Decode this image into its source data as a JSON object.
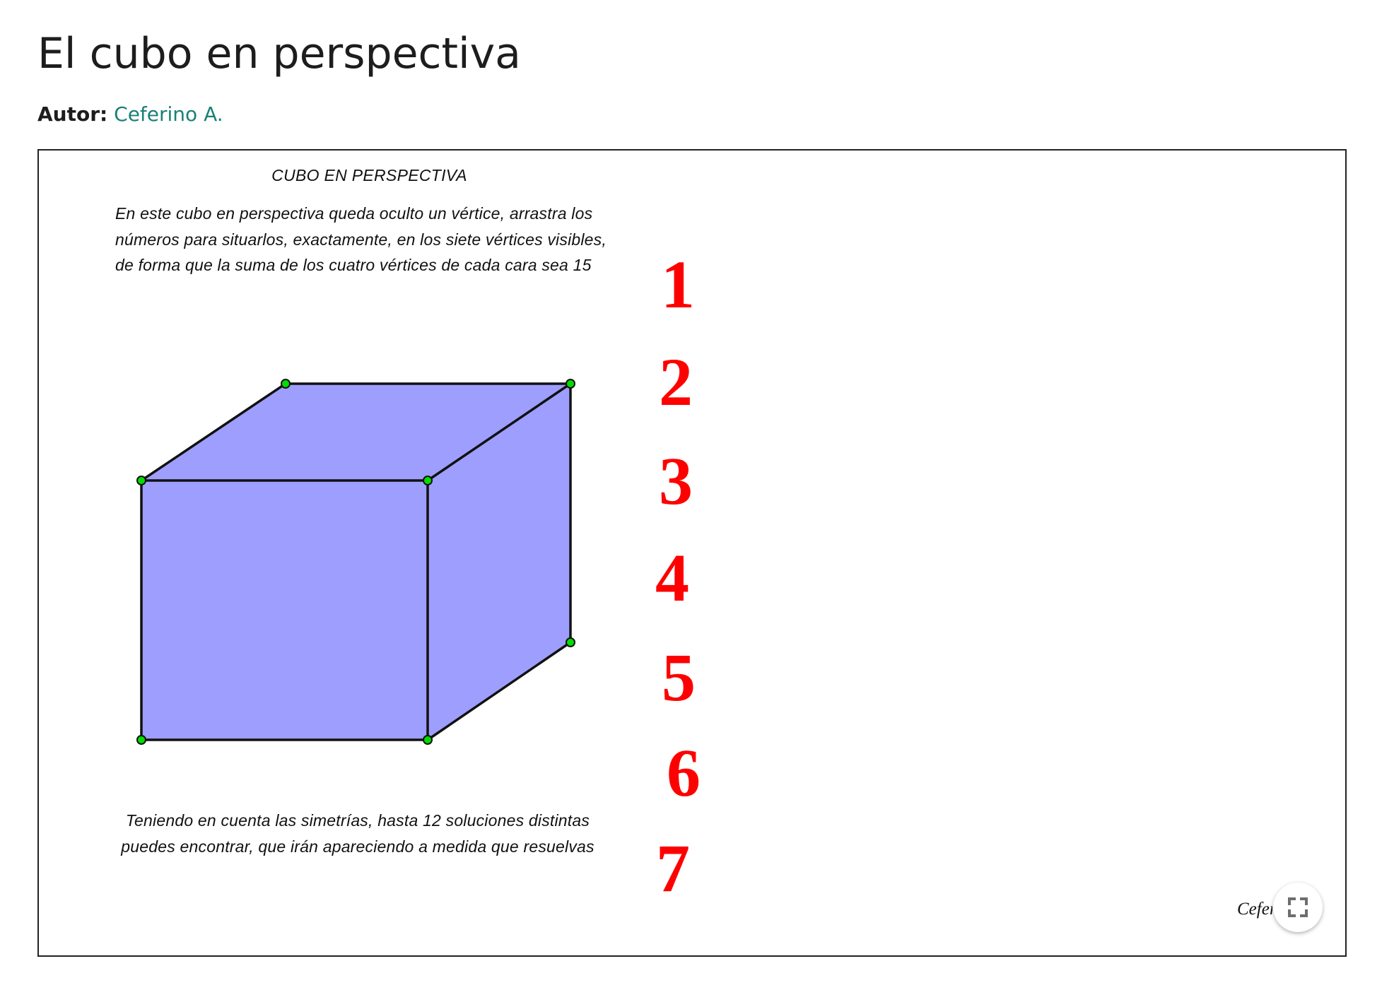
{
  "page": {
    "title": "El cubo en perspectiva",
    "author_label": "Autor:",
    "author_name": "Ceferino A."
  },
  "applet": {
    "title": "CUBO EN PERSPECTIVA",
    "description_lines": [
      "En este cubo en perspectiva queda oculto un vértice, arrastra los",
      "números para situarlos, exactamente, en los siete vértices visibles,",
      "de forma que la suma de los cuatro vértices de cada cara sea 15"
    ],
    "bottom_lines": [
      "Teniendo en cuenta las simetrías, hasta 12 soluciones distintas",
      "puedes encontrar, que irán apareciendo a medida que resuelvas"
    ],
    "numbers": [
      "1",
      "2",
      "3",
      "4",
      "5",
      "6",
      "7"
    ],
    "credit": "Ceferino A.",
    "colors": {
      "face_fill": "#9e9eff",
      "edge": "#111111",
      "vertex_point": "#00dd00",
      "number": "#ff0000"
    },
    "icons": {
      "fullscreen": "fullscreen-icon"
    }
  }
}
